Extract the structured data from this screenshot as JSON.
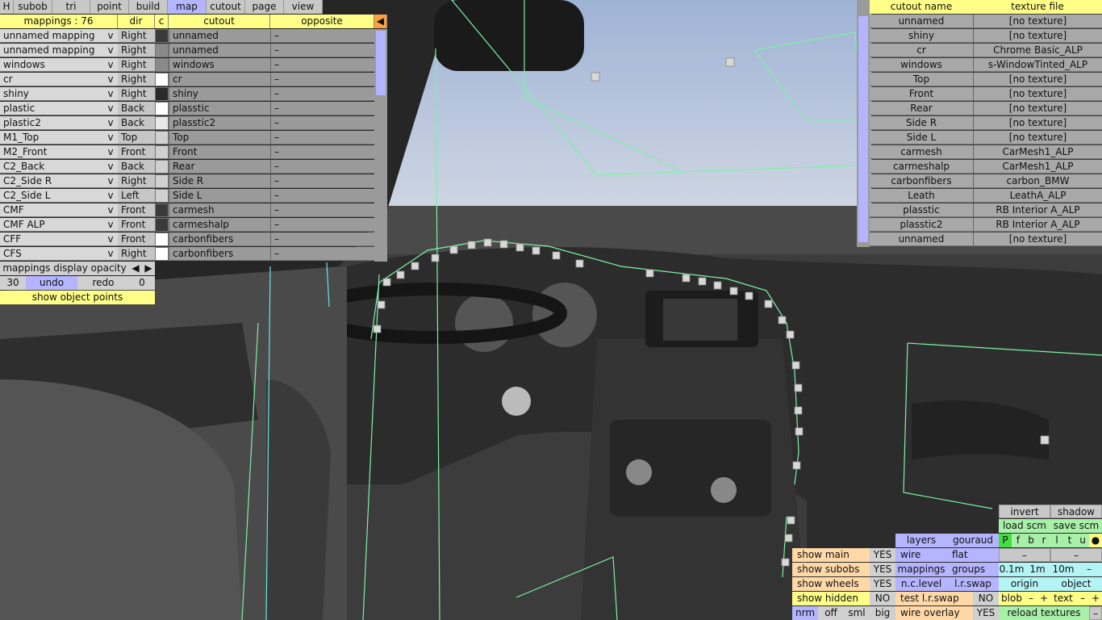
{
  "menu": {
    "tabs": [
      {
        "label": "H",
        "active": false
      },
      {
        "label": "subob",
        "active": false
      },
      {
        "label": "tri",
        "active": false
      },
      {
        "label": "point",
        "active": false
      },
      {
        "label": "build",
        "active": false
      },
      {
        "label": "map",
        "active": true
      },
      {
        "label": "cutout",
        "active": false
      },
      {
        "label": "page",
        "active": false
      },
      {
        "label": "view",
        "active": false
      }
    ]
  },
  "mappings": {
    "header": {
      "count": "mappings : 76",
      "dir": "dir",
      "c": "c",
      "cutout": "cutout",
      "opposite": "opposite"
    },
    "rows": [
      {
        "name": "unnamed mapping",
        "v": "v",
        "dir": "Right",
        "swatch": "#3a3a3a",
        "cutout": "unnamed",
        "opposite": "–"
      },
      {
        "name": "unnamed mapping",
        "v": "v",
        "dir": "Right",
        "swatch": "#8a8a8a",
        "cutout": "unnamed",
        "opposite": "–"
      },
      {
        "name": "windows",
        "v": "v",
        "dir": "Right",
        "swatch": "#8a8a8a",
        "cutout": "windows",
        "opposite": "–"
      },
      {
        "name": "cr",
        "v": "v",
        "dir": "Right",
        "swatch": "#ffffff",
        "cutout": "cr",
        "opposite": "–"
      },
      {
        "name": "shiny",
        "v": "v",
        "dir": "Right",
        "swatch": "#2a2a2a",
        "cutout": "shiny",
        "opposite": "–"
      },
      {
        "name": "plastic",
        "v": "v",
        "dir": "Back",
        "swatch": "#ffffff",
        "cutout": "plasstic",
        "opposite": "–"
      },
      {
        "name": "plastic2",
        "v": "v",
        "dir": "Back",
        "swatch": "#e8e8e8",
        "cutout": "plasstic2",
        "opposite": "–"
      },
      {
        "name": "M1_Top",
        "v": "v",
        "dir": "Top",
        "swatch": "#d0d0d0",
        "cutout": "Top",
        "opposite": "–"
      },
      {
        "name": "M2_Front",
        "v": "v",
        "dir": "Front",
        "swatch": "#d0d0d0",
        "cutout": "Front",
        "opposite": "–"
      },
      {
        "name": "C2_Back",
        "v": "v",
        "dir": "Back",
        "swatch": "#d0d0d0",
        "cutout": "Rear",
        "opposite": "–"
      },
      {
        "name": "C2_Side R",
        "v": "v",
        "dir": "Right",
        "swatch": "#d0d0d0",
        "cutout": "Side R",
        "opposite": "–"
      },
      {
        "name": "C2_Side L",
        "v": "v",
        "dir": "Left",
        "swatch": "#d0d0d0",
        "cutout": "Side L",
        "opposite": "–"
      },
      {
        "name": "CMF",
        "v": "v",
        "dir": "Front",
        "swatch": "#3a3a3a",
        "cutout": "carmesh",
        "opposite": "–"
      },
      {
        "name": "CMF ALP",
        "v": "v",
        "dir": "Front",
        "swatch": "#3a3a3a",
        "cutout": "carmeshalp",
        "opposite": "–"
      },
      {
        "name": "CFF",
        "v": "v",
        "dir": "Front",
        "swatch": "#ffffff",
        "cutout": "carbonfibers",
        "opposite": "–"
      },
      {
        "name": "CFS",
        "v": "v",
        "dir": "Right",
        "swatch": "#ffffff",
        "cutout": "carbonfibers",
        "opposite": "–"
      }
    ],
    "opacity_label": "mappings display opacity",
    "opacity_value": "30",
    "undo": "undo",
    "redo": "redo",
    "undo_count": "0",
    "show_points": "show object points"
  },
  "textures": {
    "header": {
      "name": "cutout name",
      "file": "texture file"
    },
    "rows": [
      {
        "name": "unnamed",
        "file": "[no texture]"
      },
      {
        "name": "shiny",
        "file": "[no texture]"
      },
      {
        "name": "cr",
        "file": "Chrome Basic_ALP"
      },
      {
        "name": "windows",
        "file": "s-WindowTinted_ALP"
      },
      {
        "name": "Top",
        "file": "[no texture]"
      },
      {
        "name": "Front",
        "file": "[no texture]"
      },
      {
        "name": "Rear",
        "file": "[no texture]"
      },
      {
        "name": "Side R",
        "file": "[no texture]"
      },
      {
        "name": "Side L",
        "file": "[no texture]"
      },
      {
        "name": "carmesh",
        "file": "CarMesh1_ALP"
      },
      {
        "name": "carmeshalp",
        "file": "CarMesh1_ALP"
      },
      {
        "name": "carbonfibers",
        "file": "carbon_BMW"
      },
      {
        "name": "Leath",
        "file": "LeathA_ALP"
      },
      {
        "name": "plasstic",
        "file": "RB Interior A_ALP"
      },
      {
        "name": "plasstic2",
        "file": "RB Interior A_ALP"
      },
      {
        "name": "unnamed",
        "file": "[no texture]"
      }
    ]
  },
  "controls": {
    "invert": "invert",
    "shadow": "shadow",
    "load_scm": "load scm",
    "save_scm": "save scm",
    "layers": "layers",
    "gouraud": "gouraud",
    "pfbrltu": [
      "P",
      "f",
      "b",
      "r",
      "l",
      "t",
      "u"
    ],
    "dot": "●",
    "show_main": "show main",
    "show_main_val": "YES",
    "wire": "wire",
    "flat": "flat",
    "dash1": "–",
    "dash2": "–",
    "show_subobs": "show subobs",
    "show_subobs_val": "YES",
    "mappings": "mappings",
    "groups": "groups",
    "step_01": "0.1m",
    "step_1": "1m",
    "step_10": "10m",
    "step_dash": "–",
    "show_wheels": "show wheels",
    "show_wheels_val": "YES",
    "nc_level": "n.c.level",
    "lr_swap": "l.r.swap",
    "origin": "origin",
    "object": "object",
    "show_hidden": "show hidden",
    "show_hidden_val": "NO",
    "test_lr_swap": "test l.r.swap",
    "test_lr_swap_val": "NO",
    "blob": "blob",
    "blob_minus": "–",
    "blob_plus": "+",
    "text": "text",
    "text_minus": "–",
    "text_plus": "+",
    "nrm": "nrm",
    "off": "off",
    "sml": "sml",
    "big": "big",
    "wire_overlay": "wire overlay",
    "wire_overlay_val": "YES",
    "reload_textures": "reload textures",
    "reload_dash": "–"
  }
}
